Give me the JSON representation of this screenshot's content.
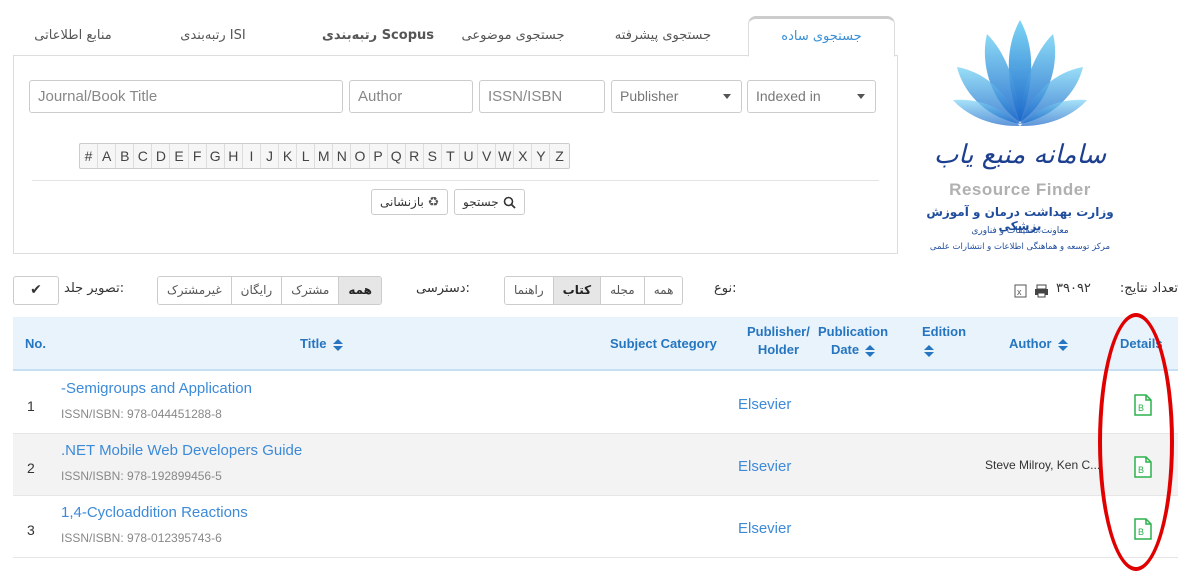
{
  "tabs": [
    "منابع اطلاعاتی",
    "رتبه‌بندی ISI",
    "رتبه‌بندی Scopus",
    "جستجوی موضوعی",
    "جستجوی پیشرفته",
    "جستجوی ساده"
  ],
  "search": {
    "title_placeholder": "Journal/Book Title",
    "author_placeholder": "Author",
    "issn_placeholder": "ISSN/ISBN",
    "publisher_select": "Publisher",
    "indexed_select": "Indexed in",
    "alphabet": [
      "#",
      "A",
      "B",
      "C",
      "D",
      "E",
      "F",
      "G",
      "H",
      "I",
      "J",
      "K",
      "L",
      "M",
      "N",
      "O",
      "P",
      "Q",
      "R",
      "S",
      "T",
      "U",
      "V",
      "W",
      "X",
      "Y",
      "Z"
    ],
    "search_button": "جستجو",
    "reset_button": "بازنشانی"
  },
  "logo": {
    "brand_fa": "سامانه منبع یاب",
    "brand_en": "Resource Finder",
    "line1": "وزارت بهداشت درمان و آموزش پزشکی",
    "line2": "معاونت تحقیقات و فناوری",
    "line3": "مرکز توسعه و هماهنگی اطلاعات و انتشارات علمی"
  },
  "toolbar": {
    "cover_label": "تصویر جلد:",
    "access_label": "دسترسی:",
    "access_options": [
      "غیرمشترک",
      "رایگان",
      "مشترک",
      "همه"
    ],
    "access_selected": "همه",
    "type_label": "نوع:",
    "type_options": [
      "راهنما",
      "کتاب",
      "مجله",
      "همه"
    ],
    "type_selected": "کتاب",
    "results_label": "تعداد نتایج:",
    "results_count": "۳۹۰۹۲"
  },
  "table": {
    "headers": {
      "no": "No.",
      "title": "Title",
      "subject": "Subject Category",
      "publisher_1": "Publisher/",
      "publisher_2": "Holder",
      "pubdate_1": "Publication",
      "pubdate_2": "Date",
      "edition": "Edition",
      "author": "Author",
      "details": "Details"
    },
    "rows": [
      {
        "no": "1",
        "title": "-Semigroups and Application",
        "isbn": "ISSN/ISBN: 978-044451288-8",
        "publisher": "Elsevier",
        "author": ""
      },
      {
        "no": "2",
        "title": ".NET Mobile Web Developers Guide",
        "isbn": "ISSN/ISBN: 978-192899456-5",
        "publisher": "Elsevier",
        "author": "Steve Milroy, Ken C..."
      },
      {
        "no": "3",
        "title": "1,4-Cycloaddition Reactions",
        "isbn": "ISSN/ISBN: 978-012395743-6",
        "publisher": "Elsevier",
        "author": ""
      }
    ]
  },
  "colors": {
    "accent": "#3c8ad8",
    "header_bg": "#e9f3fb",
    "highlight": "#e10000",
    "detail_icon": "#2bb24c"
  }
}
